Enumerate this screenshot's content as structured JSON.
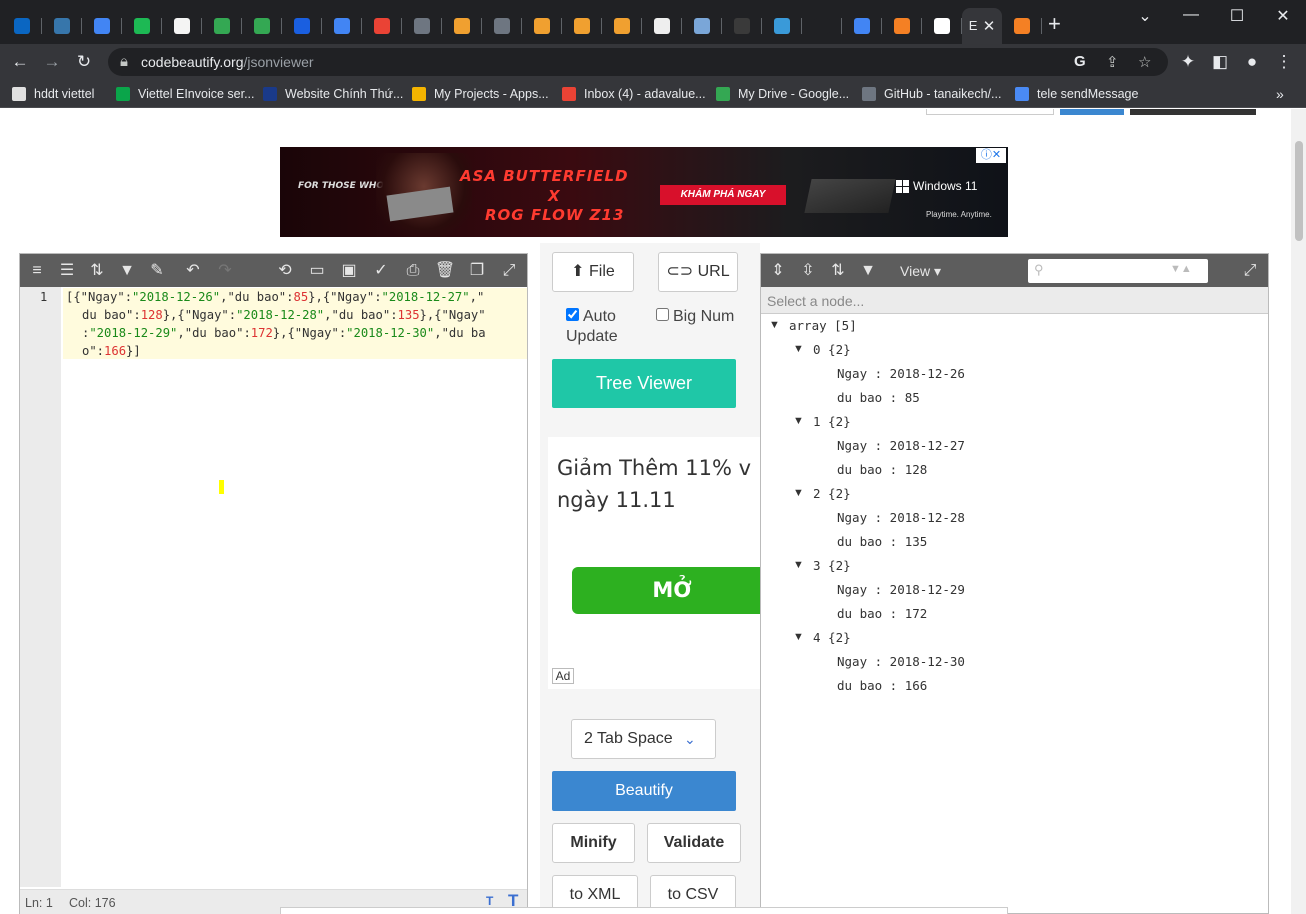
{
  "browser": {
    "tabs": [
      {
        "icon": "outlook-icon",
        "color": "#0a66c2"
      },
      {
        "icon": "python-icon",
        "color": "#3776ab"
      },
      {
        "icon": "translate-icon",
        "color": "#4285f4"
      },
      {
        "icon": "vscode-icon",
        "color": "#1db954"
      },
      {
        "icon": "sheet-icon",
        "color": "#f4f4f4"
      },
      {
        "icon": "refresh-green-icon",
        "color": "#34a853"
      },
      {
        "icon": "refresh-green-icon",
        "color": "#34a853"
      },
      {
        "icon": "bluedoc-icon",
        "color": "#1a5fe0"
      },
      {
        "icon": "docs-icon",
        "color": "#4285f4"
      },
      {
        "icon": "gmail-icon",
        "color": "#ea4335"
      },
      {
        "icon": "github-icon",
        "color": "#6e7681"
      },
      {
        "icon": "infinity-icon",
        "color": "#f0a030"
      },
      {
        "icon": "github-icon",
        "color": "#6e7681"
      },
      {
        "icon": "infinity-icon",
        "color": "#f0a030"
      },
      {
        "icon": "infinity-icon",
        "color": "#f0a030"
      },
      {
        "icon": "infinity-icon",
        "color": "#f0a030"
      },
      {
        "icon": "pinwheel-icon",
        "color": "#eeeeee"
      },
      {
        "icon": "globe-icon",
        "color": "#7aa6d8"
      },
      {
        "icon": "dark-icon",
        "color": "#3a3a3a"
      },
      {
        "icon": "k-icon",
        "color": "#3a9ad9"
      },
      {
        "icon": "blank-icon",
        "color": "#202124"
      },
      {
        "icon": "docs-icon",
        "color": "#4285f4"
      },
      {
        "icon": "stackoverflow-icon",
        "color": "#f48024"
      },
      {
        "icon": "globe-white-icon",
        "color": "#ffffff"
      },
      {
        "icon": "e-icon",
        "color": "#35363a",
        "active": true,
        "label": "E"
      },
      {
        "icon": "stackoverflow-icon",
        "color": "#f48024"
      }
    ],
    "url_host": "codebeautify.org",
    "url_path": "/jsonviewer",
    "bookmarks": [
      {
        "label": "hddt viettel",
        "color": "#e0e0e0"
      },
      {
        "label": "Viettel EInvoice ser...",
        "color": "#0aa54a"
      },
      {
        "label": "Website Chính Thứ...",
        "color": "#1a3a8a"
      },
      {
        "label": "My Projects - Apps...",
        "color": "#f4b400"
      },
      {
        "label": "Inbox (4) - adavalue...",
        "color": "#ea4335"
      },
      {
        "label": "My Drive - Google...",
        "color": "#34a853"
      },
      {
        "label": "GitHub - tanaikech/...",
        "color": "#6e7681"
      },
      {
        "label": "tele sendMessage",
        "color": "#4a8af4"
      }
    ]
  },
  "page": {
    "banner": {
      "line1": "FOR THOSE WHO DARE",
      "line2": "ASA BUTTERFIELD",
      "line3": "X",
      "line4": "ROG FLOW Z13",
      "cta": "KHÁM PHÁ NGAY",
      "brand": "Windows 11",
      "tagline": "Playtime. Anytime."
    },
    "editor": {
      "line_number": "1",
      "status_line": "Ln: 1",
      "status_col": "Col: 176"
    },
    "middle": {
      "file_label": "File",
      "url_label": "URL",
      "auto_update_label": "Auto Update",
      "auto_update_checked": true,
      "big_num_label": "Big Num",
      "big_num_checked": false,
      "tree_viewer_label": "Tree Viewer",
      "ad_text_line1": "Giảm Thêm 11% v",
      "ad_text_line2": "ngày 11.11",
      "ad_open_label": "MỞ",
      "ad_badge": "Ad",
      "tab_space_value": "2 Tab Space",
      "beautify_label": "Beautify",
      "minify_label": "Minify",
      "validate_label": "Validate",
      "to_xml_label": "to XML",
      "to_csv_label": "to CSV"
    },
    "viewer": {
      "view_label": "View",
      "node_placeholder": "Select a node...",
      "root_label": "array",
      "root_count": "[5]",
      "items": [
        {
          "index": "0",
          "count": "{2}",
          "ngay": "2018-12-26",
          "du_bao": 85
        },
        {
          "index": "1",
          "count": "{2}",
          "ngay": "2018-12-27",
          "du_bao": 128
        },
        {
          "index": "2",
          "count": "{2}",
          "ngay": "2018-12-28",
          "du_bao": 135
        },
        {
          "index": "3",
          "count": "{2}",
          "ngay": "2018-12-29",
          "du_bao": 172
        },
        {
          "index": "4",
          "count": "{2}",
          "ngay": "2018-12-30",
          "du_bao": 166
        }
      ],
      "key_ngay": "Ngay",
      "key_du_bao": "du bao"
    }
  }
}
